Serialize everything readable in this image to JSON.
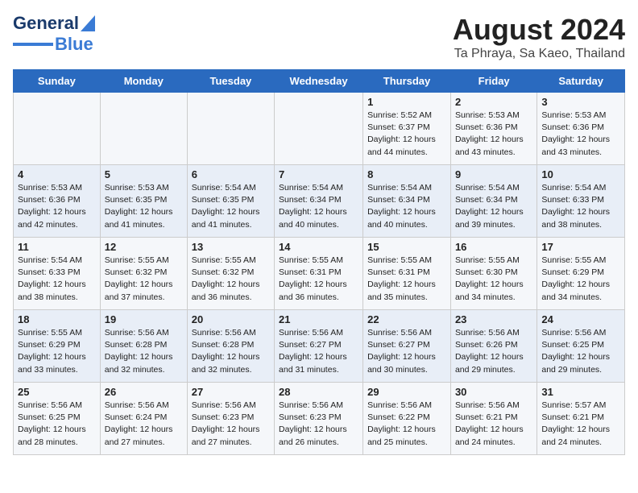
{
  "header": {
    "logo_general": "General",
    "logo_blue": "Blue",
    "month": "August 2024",
    "location": "Ta Phraya, Sa Kaeo, Thailand"
  },
  "weekdays": [
    "Sunday",
    "Monday",
    "Tuesday",
    "Wednesday",
    "Thursday",
    "Friday",
    "Saturday"
  ],
  "weeks": [
    [
      {
        "day": "",
        "info": ""
      },
      {
        "day": "",
        "info": ""
      },
      {
        "day": "",
        "info": ""
      },
      {
        "day": "",
        "info": ""
      },
      {
        "day": "1",
        "info": "Sunrise: 5:52 AM\nSunset: 6:37 PM\nDaylight: 12 hours\nand 44 minutes."
      },
      {
        "day": "2",
        "info": "Sunrise: 5:53 AM\nSunset: 6:36 PM\nDaylight: 12 hours\nand 43 minutes."
      },
      {
        "day": "3",
        "info": "Sunrise: 5:53 AM\nSunset: 6:36 PM\nDaylight: 12 hours\nand 43 minutes."
      }
    ],
    [
      {
        "day": "4",
        "info": "Sunrise: 5:53 AM\nSunset: 6:36 PM\nDaylight: 12 hours\nand 42 minutes."
      },
      {
        "day": "5",
        "info": "Sunrise: 5:53 AM\nSunset: 6:35 PM\nDaylight: 12 hours\nand 41 minutes."
      },
      {
        "day": "6",
        "info": "Sunrise: 5:54 AM\nSunset: 6:35 PM\nDaylight: 12 hours\nand 41 minutes."
      },
      {
        "day": "7",
        "info": "Sunrise: 5:54 AM\nSunset: 6:34 PM\nDaylight: 12 hours\nand 40 minutes."
      },
      {
        "day": "8",
        "info": "Sunrise: 5:54 AM\nSunset: 6:34 PM\nDaylight: 12 hours\nand 40 minutes."
      },
      {
        "day": "9",
        "info": "Sunrise: 5:54 AM\nSunset: 6:34 PM\nDaylight: 12 hours\nand 39 minutes."
      },
      {
        "day": "10",
        "info": "Sunrise: 5:54 AM\nSunset: 6:33 PM\nDaylight: 12 hours\nand 38 minutes."
      }
    ],
    [
      {
        "day": "11",
        "info": "Sunrise: 5:54 AM\nSunset: 6:33 PM\nDaylight: 12 hours\nand 38 minutes."
      },
      {
        "day": "12",
        "info": "Sunrise: 5:55 AM\nSunset: 6:32 PM\nDaylight: 12 hours\nand 37 minutes."
      },
      {
        "day": "13",
        "info": "Sunrise: 5:55 AM\nSunset: 6:32 PM\nDaylight: 12 hours\nand 36 minutes."
      },
      {
        "day": "14",
        "info": "Sunrise: 5:55 AM\nSunset: 6:31 PM\nDaylight: 12 hours\nand 36 minutes."
      },
      {
        "day": "15",
        "info": "Sunrise: 5:55 AM\nSunset: 6:31 PM\nDaylight: 12 hours\nand 35 minutes."
      },
      {
        "day": "16",
        "info": "Sunrise: 5:55 AM\nSunset: 6:30 PM\nDaylight: 12 hours\nand 34 minutes."
      },
      {
        "day": "17",
        "info": "Sunrise: 5:55 AM\nSunset: 6:29 PM\nDaylight: 12 hours\nand 34 minutes."
      }
    ],
    [
      {
        "day": "18",
        "info": "Sunrise: 5:55 AM\nSunset: 6:29 PM\nDaylight: 12 hours\nand 33 minutes."
      },
      {
        "day": "19",
        "info": "Sunrise: 5:56 AM\nSunset: 6:28 PM\nDaylight: 12 hours\nand 32 minutes."
      },
      {
        "day": "20",
        "info": "Sunrise: 5:56 AM\nSunset: 6:28 PM\nDaylight: 12 hours\nand 32 minutes."
      },
      {
        "day": "21",
        "info": "Sunrise: 5:56 AM\nSunset: 6:27 PM\nDaylight: 12 hours\nand 31 minutes."
      },
      {
        "day": "22",
        "info": "Sunrise: 5:56 AM\nSunset: 6:27 PM\nDaylight: 12 hours\nand 30 minutes."
      },
      {
        "day": "23",
        "info": "Sunrise: 5:56 AM\nSunset: 6:26 PM\nDaylight: 12 hours\nand 29 minutes."
      },
      {
        "day": "24",
        "info": "Sunrise: 5:56 AM\nSunset: 6:25 PM\nDaylight: 12 hours\nand 29 minutes."
      }
    ],
    [
      {
        "day": "25",
        "info": "Sunrise: 5:56 AM\nSunset: 6:25 PM\nDaylight: 12 hours\nand 28 minutes."
      },
      {
        "day": "26",
        "info": "Sunrise: 5:56 AM\nSunset: 6:24 PM\nDaylight: 12 hours\nand 27 minutes."
      },
      {
        "day": "27",
        "info": "Sunrise: 5:56 AM\nSunset: 6:23 PM\nDaylight: 12 hours\nand 27 minutes."
      },
      {
        "day": "28",
        "info": "Sunrise: 5:56 AM\nSunset: 6:23 PM\nDaylight: 12 hours\nand 26 minutes."
      },
      {
        "day": "29",
        "info": "Sunrise: 5:56 AM\nSunset: 6:22 PM\nDaylight: 12 hours\nand 25 minutes."
      },
      {
        "day": "30",
        "info": "Sunrise: 5:56 AM\nSunset: 6:21 PM\nDaylight: 12 hours\nand 24 minutes."
      },
      {
        "day": "31",
        "info": "Sunrise: 5:57 AM\nSunset: 6:21 PM\nDaylight: 12 hours\nand 24 minutes."
      }
    ]
  ]
}
